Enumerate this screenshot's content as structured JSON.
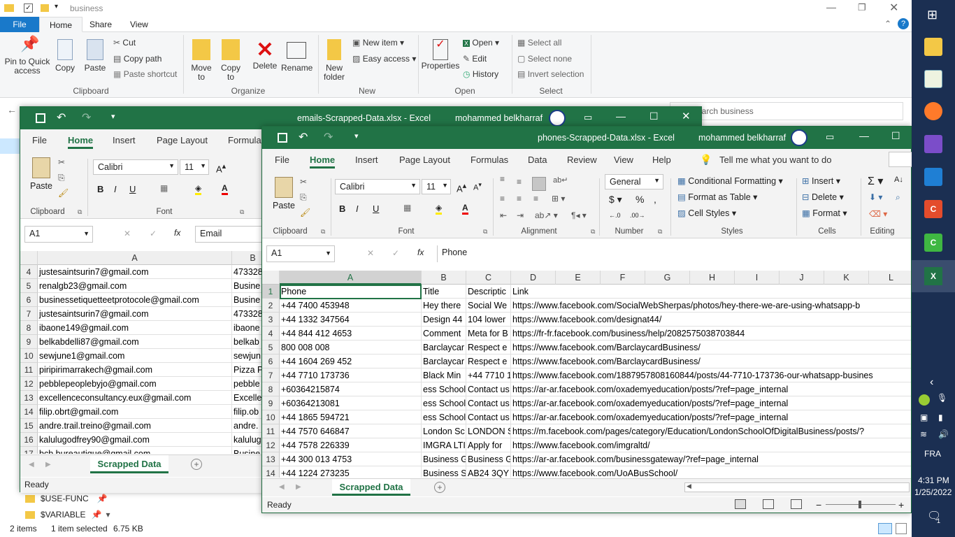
{
  "explorer": {
    "title": "business",
    "tabs": [
      "File",
      "Home",
      "Share",
      "View"
    ],
    "clipboard": {
      "pin": "Pin to Quick access",
      "copy": "Copy",
      "paste": "Paste",
      "cut": "Cut",
      "copy_path": "Copy path",
      "paste_shortcut": "Paste shortcut",
      "group": "Clipboard"
    },
    "organize": {
      "move": "Move to",
      "copy": "Copy to",
      "delete": "Delete",
      "rename": "Rename",
      "group": "Organize"
    },
    "new": {
      "folder": "New folder",
      "item": "New item",
      "easy": "Easy access",
      "group": "New"
    },
    "open": {
      "properties": "Properties",
      "open": "Open",
      "edit": "Edit",
      "history": "History",
      "group": "Open"
    },
    "select": {
      "all": "Select all",
      "none": "Select none",
      "invert": "Invert selection",
      "group": "Select"
    },
    "search_placeholder": "earch business",
    "side_items": [
      "$USE-FUNC",
      "$VARIABLE"
    ],
    "status": {
      "items": "2 items",
      "selected": "1 item selected",
      "size": "6.75 KB"
    }
  },
  "emails": {
    "title": "emails-Scrapped-Data.xlsx  -  Excel",
    "user": "mohammed belkharraf",
    "tabs": [
      "File",
      "Home",
      "Insert",
      "Page Layout",
      "Formulas"
    ],
    "font": "Calibri",
    "size": "11",
    "groups": {
      "clipboard": "Clipboard",
      "font": "Font"
    },
    "paste": "Paste",
    "namebox": "A1",
    "formula": "Email",
    "col_a": "A",
    "col_b": "B",
    "rows": [
      {
        "n": "4",
        "a": "justesaintsurin7@gmail.com",
        "b": "473328"
      },
      {
        "n": "5",
        "a": "renalgb23@gmail.com",
        "b": "Busine"
      },
      {
        "n": "6",
        "a": "businessetiquetteetprotocole@gmail.com",
        "b": "Busine"
      },
      {
        "n": "7",
        "a": "justesaintsurin7@gmail.com",
        "b": "473328"
      },
      {
        "n": "8",
        "a": "ibaone149@gmail.com",
        "b": "ibaone"
      },
      {
        "n": "9",
        "a": "belkabdelli87@gmail.com",
        "b": "belkab"
      },
      {
        "n": "10",
        "a": "sewjune1@gmail.com",
        "b": "sewjun"
      },
      {
        "n": "11",
        "a": "piripirimarrakech@gmail.com",
        "b": "Pizza P"
      },
      {
        "n": "12",
        "a": "pebblepeoplebyjo@gmail.com",
        "b": "pebble"
      },
      {
        "n": "13",
        "a": "excellenceconsultancy.eux@gmail.com",
        "b": "Excelle"
      },
      {
        "n": "14",
        "a": "filip.obrt@gmail.com",
        "b": "filip.ob"
      },
      {
        "n": "15",
        "a": "andre.trail.treino@gmail.com",
        "b": "andre."
      },
      {
        "n": "16",
        "a": "kalulugodfrey90@gmail.com",
        "b": "kalulug"
      },
      {
        "n": "17",
        "a": "bcb.bureautique@gmail.com",
        "b": "Busine"
      }
    ],
    "sheet": "Scrapped Data",
    "status": "Ready"
  },
  "phones": {
    "title": "phones-Scrapped-Data.xlsx  -  Excel",
    "user": "mohammed belkharraf",
    "tabs": [
      "File",
      "Home",
      "Insert",
      "Page Layout",
      "Formulas",
      "Data",
      "Review",
      "View",
      "Help"
    ],
    "tellme": "Tell me what you want to do",
    "font": "Calibri",
    "size": "11",
    "numfmt": "General",
    "paste": "Paste",
    "styles": {
      "cond": "Conditional Formatting",
      "table": "Format as Table",
      "cell": "Cell Styles"
    },
    "cells": {
      "insert": "Insert",
      "delete": "Delete",
      "format": "Format"
    },
    "groups": {
      "clipboard": "Clipboard",
      "font": "Font",
      "alignment": "Alignment",
      "number": "Number",
      "styles": "Styles",
      "cells": "Cells",
      "editing": "Editing"
    },
    "namebox": "A1",
    "formula": "Phone",
    "cols": [
      "A",
      "B",
      "C",
      "D",
      "E",
      "F",
      "G",
      "H",
      "I",
      "J",
      "K",
      "L"
    ],
    "rows": [
      {
        "n": "1",
        "a": "Phone",
        "b": "Title",
        "c": "Descriptic",
        "d": "Link"
      },
      {
        "n": "2",
        "a": "+44 7400 453948",
        "b": "Hey there",
        "c": "Social We",
        "d": "https://www.facebook.com/SocialWebSherpas/photos/hey-there-we-are-using-whatsapp-b"
      },
      {
        "n": "3",
        "a": "+44 1332 347564",
        "b": "Design 44",
        "c": "104 lower",
        "d": "https://www.facebook.com/designat44/"
      },
      {
        "n": "4",
        "a": "+44 844 412 4653",
        "b": "Comment",
        "c": "Meta for B",
        "d": "https://fr-fr.facebook.com/business/help/2082575038703844"
      },
      {
        "n": "5",
        "a": "800 008 008",
        "b": "Barclaycar",
        "c": "Respect e",
        "d": "https://www.facebook.com/BarclaycardBusiness/"
      },
      {
        "n": "6",
        "a": "+44 1604 269 452",
        "b": "Barclaycar",
        "c": "Respect e",
        "d": "https://www.facebook.com/BarclaycardBusiness/"
      },
      {
        "n": "7",
        "a": "+44 7710 173736",
        "b": "Black Min",
        "c": "+44 7710 1",
        "d": "https://www.facebook.com/1887957808160844/posts/44-7710-173736-our-whatsapp-busines"
      },
      {
        "n": "8",
        "a": "+60364215874",
        "b": "ess School",
        "c": "Contact us",
        "d": "https://ar-ar.facebook.com/oxademyeducation/posts/?ref=page_internal"
      },
      {
        "n": "9",
        "a": "+60364213081",
        "b": "ess School",
        "c": "Contact us",
        "d": "https://ar-ar.facebook.com/oxademyeducation/posts/?ref=page_internal"
      },
      {
        "n": "10",
        "a": "+44 1865 594721",
        "b": "ess School",
        "c": "Contact us",
        "d": "https://ar-ar.facebook.com/oxademyeducation/posts/?ref=page_internal"
      },
      {
        "n": "11",
        "a": "+44 7570 646847",
        "b": "London Sc",
        "c": "LONDON S",
        "d": "https://m.facebook.com/pages/category/Education/LondonSchoolOfDigitalBusiness/posts/?"
      },
      {
        "n": "12",
        "a": "+44 7578 226339",
        "b": "IMGRA LTI",
        "c": "Apply for",
        "d": "https://www.facebook.com/imgraltd/"
      },
      {
        "n": "13",
        "a": "+44 300 013 4753",
        "b": "Business G",
        "c": "Business G",
        "d": "https://ar-ar.facebook.com/businessgateway/?ref=page_internal"
      },
      {
        "n": "14",
        "a": "+44 1224 273235",
        "b": "Business S",
        "c": "AB24 3QY",
        "d": "https://www.facebook.com/UoABusSchool/"
      }
    ],
    "sheet": "Scrapped Data",
    "status": "Ready"
  },
  "taskbar": {
    "time": "4:31 PM",
    "date": "1/25/2022",
    "lang": "FRA",
    "notif": "1"
  }
}
